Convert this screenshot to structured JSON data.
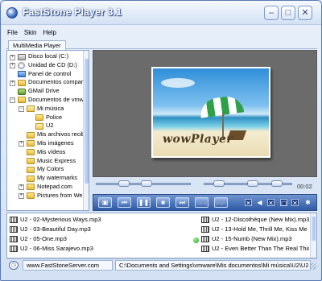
{
  "window": {
    "title": "FastStone Player 3.1",
    "buttons": {
      "minimize": "–",
      "maximize": "□",
      "close": "✕"
    }
  },
  "menu": [
    "File",
    "Skin",
    "Help"
  ],
  "tab": "MultiMedia Player",
  "tree": [
    {
      "label": "Disco local (C:)",
      "icon": "hard-drive-icon",
      "expander": "+",
      "indent": 0
    },
    {
      "label": "Unidad de CD (D:)",
      "icon": "cd-drive-icon",
      "expander": "+",
      "indent": 0
    },
    {
      "label": "Panel de control",
      "icon": "control-panel-icon",
      "expander": "",
      "indent": 0
    },
    {
      "label": "Documentos compartidos",
      "icon": "folder-icon",
      "expander": "+",
      "indent": 0
    },
    {
      "label": "GMail Drive",
      "icon": "gmail-drive-icon",
      "expander": "",
      "indent": 0
    },
    {
      "label": "Documentos de vmware",
      "icon": "folder-icon",
      "expander": "−",
      "indent": 0
    },
    {
      "label": "Mi música",
      "icon": "open-folder-icon",
      "expander": "−",
      "indent": 1
    },
    {
      "label": "Police",
      "icon": "folder-icon",
      "expander": "",
      "indent": 2
    },
    {
      "label": "U2",
      "icon": "open-folder-icon",
      "expander": "",
      "indent": 2
    },
    {
      "label": "Mis archivos recibidos",
      "icon": "folder-icon",
      "expander": "",
      "indent": 1
    },
    {
      "label": "Mis imágenes",
      "icon": "folder-icon",
      "expander": "+",
      "indent": 1
    },
    {
      "label": "Mis vídeos",
      "icon": "folder-icon",
      "expander": "",
      "indent": 1
    },
    {
      "label": "Music Express",
      "icon": "folder-icon",
      "expander": "",
      "indent": 1
    },
    {
      "label": "My Colors",
      "icon": "folder-icon",
      "expander": "",
      "indent": 1
    },
    {
      "label": "My watermarks",
      "icon": "folder-icon",
      "expander": "",
      "indent": 1
    },
    {
      "label": "Notepad.com",
      "icon": "folder-icon",
      "expander": "+",
      "indent": 1
    },
    {
      "label": "Pictures from Web",
      "icon": "folder-icon",
      "expander": "+",
      "indent": 1
    }
  ],
  "artwork_text": "wowPlayer",
  "time_display": "00:02",
  "playlist_left": [
    "U2 - 02-Mysterious Ways.mp3",
    "U2 - 03-Beautiful Day.mp3",
    "U2 - 05-One.mp3",
    "U2 - 06-Miss Sarajevo.mp3"
  ],
  "playlist_right": [
    "U2 - 12-Discothèque (New Mix).mp3",
    "U2 - 13-Hold Me, Thrill Me, Kiss Me",
    "U2 - 15-Numb (New Mix).mp3",
    "U2 - Even Better Than The Real Thing"
  ],
  "now_playing": "U2 - 15-Numb (New Mix).mp3",
  "status": {
    "website": "www.FastStoneServer.com",
    "path": "C:\\Documents and Settings\\vmware\\Mis documentos\\Mi música\\U2\\U2"
  },
  "colors": {
    "window_frame": "#5b7bb4",
    "control_bar": "#2f5aa4",
    "viewer_bg": "#6b6b6b"
  }
}
